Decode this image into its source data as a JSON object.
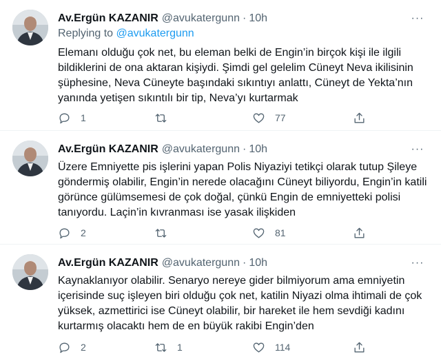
{
  "theme": {
    "accent": "#1d9bf0",
    "muted": "#536471",
    "text": "#0f1419",
    "divider": "#eff3f4"
  },
  "icons": {
    "reply": "reply-icon",
    "retweet": "retweet-icon",
    "like": "heart-icon",
    "share": "share-icon",
    "more": "more-icon"
  },
  "tweets": [
    {
      "name": "Av.Ergün KAZANIR",
      "handle": "@avukatergunn",
      "dot": "·",
      "time": "10h",
      "more": "···",
      "replying_prefix": "Replying to ",
      "replying_to": "@avukatergunn",
      "text": "Elemanı olduğu çok net, bu eleman belki de Engin’in birçok kişi ile ilgili\nbildiklerini de ona aktaran kişiydi. Şimdi gel gelelim Cüneyt Neva ikilisinin\nşüphesine, Neva Cüneyte başındaki sıkıntıyı anlattı, Cüneyt de Yekta’nın\nyanında yetişen sıkıntılı bir tip, Neva’yı kurtarmak",
      "replies": "1",
      "retweets": "",
      "likes": "77"
    },
    {
      "name": "Av.Ergün KAZANIR",
      "handle": "@avukatergunn",
      "dot": "·",
      "time": "10h",
      "more": "···",
      "text": "Üzere Emniyette pis işlerini yapan Polis Niyaziyi tetikçi olarak tutup Şileye\ngöndermiş olabilir, Engin’in nerede olacağını Cüneyt biliyordu, Engin’in katili\ngörünce gülümsemesi de çok doğal, çünkü Engin de emniyetteki polisi\ntanıyordu. Laçin’in kıvranması ise yasak ilişkiden",
      "replies": "2",
      "retweets": "",
      "likes": "81"
    },
    {
      "name": "Av.Ergün KAZANIR",
      "handle": "@avukatergunn",
      "dot": "·",
      "time": "10h",
      "more": "···",
      "text": "Kaynaklanıyor olabilir. Senaryo nereye gider bilmiyorum ama emniyetin\niçerisinde suç işleyen biri olduğu çok net, katilin Niyazi olma ihtimali de çok\nyüksek, azmettirici ise Cüneyt olabilir, bir hareket ile hem sevdiği kadını\nkurtarmış olacaktı hem de en büyük rakibi Engin’den",
      "replies": "2",
      "retweets": "1",
      "likes": "114"
    }
  ]
}
